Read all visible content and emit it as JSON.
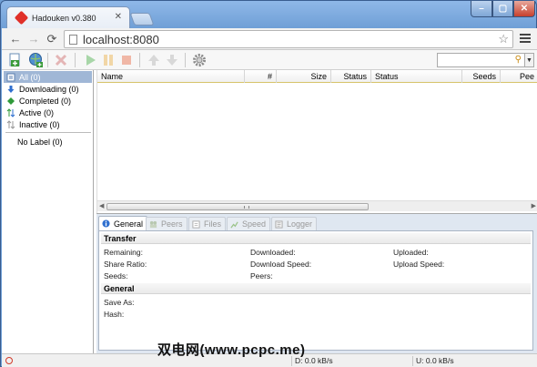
{
  "window": {
    "tab_title": "Hadouken v0.380",
    "tab_close": "✕"
  },
  "browser": {
    "url": "localhost:8080",
    "back": "←",
    "forward": "→",
    "reload": "⟳",
    "star": "☆"
  },
  "toolbar": {
    "search_placeholder": "",
    "search_icon": "magnifier-icon"
  },
  "sidebar": {
    "items": [
      {
        "label": "All (0)",
        "icon": "all-icon"
      },
      {
        "label": "Downloading (0)",
        "icon": "download-icon"
      },
      {
        "label": "Completed (0)",
        "icon": "completed-icon"
      },
      {
        "label": "Active (0)",
        "icon": "active-icon"
      },
      {
        "label": "Inactive (0)",
        "icon": "inactive-icon"
      }
    ],
    "label_item": "No Label (0)"
  },
  "list": {
    "columns": [
      "Name",
      "#",
      "Size",
      "Status",
      "Status",
      "Seeds",
      "Pee"
    ]
  },
  "details": {
    "tabs": [
      "General",
      "Peers",
      "Files",
      "Speed",
      "Logger"
    ],
    "sections": {
      "transfer": "Transfer",
      "general": "General"
    },
    "fields": {
      "remaining": "Remaining:",
      "downloaded": "Downloaded:",
      "uploaded": "Uploaded:",
      "share_ratio": "Share Ratio:",
      "download_speed": "Download Speed:",
      "upload_speed": "Upload Speed:",
      "seeds": "Seeds:",
      "peers": "Peers:",
      "save_as": "Save As:",
      "hash": "Hash:"
    }
  },
  "status": {
    "download": "D: 0.0 kB/s",
    "upload": "U: 0.0 kB/s"
  },
  "watermark": "双电网(www.pcpc.me)",
  "colors": {
    "accent": "#a0b7d6",
    "frame": "#6f9fd6",
    "close": "#c7402d"
  }
}
